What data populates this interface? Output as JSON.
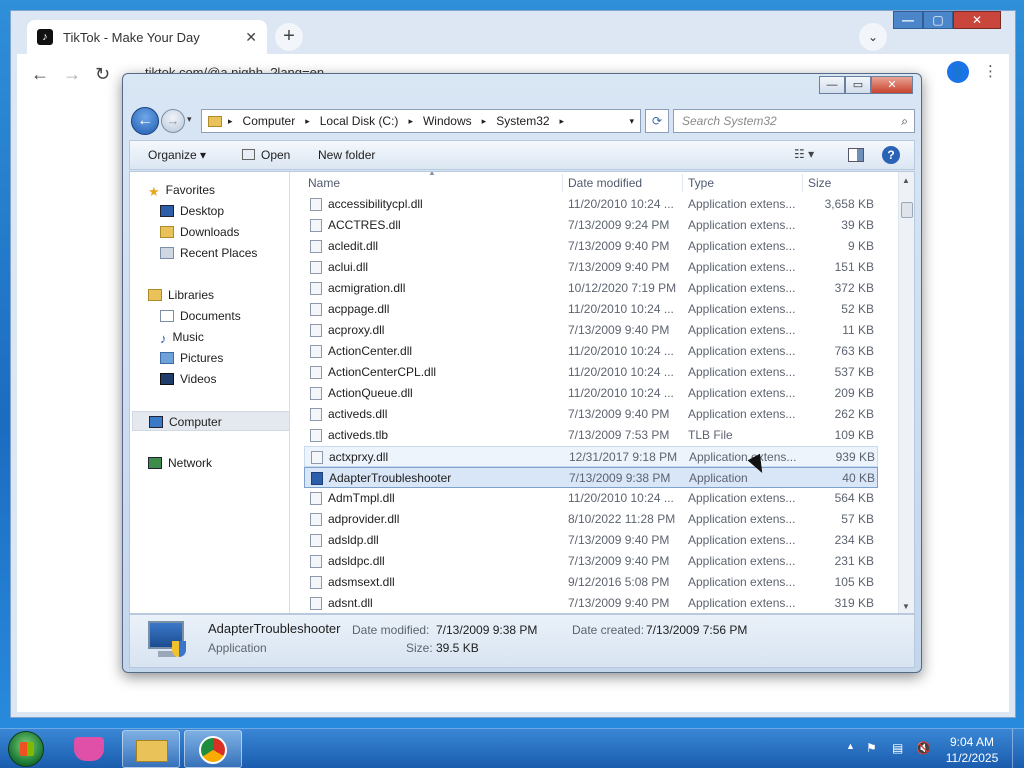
{
  "browser": {
    "tab_title": "TikTok - Make Your Day",
    "tab_close": "✕",
    "new_tab": "+",
    "tab_search": "⌄",
    "url": "tiktok.com/@a.nighh_?lang=en",
    "back": "←",
    "forward": "→",
    "reload": "↻",
    "menu": "⋮",
    "win_min": "—",
    "win_max": "▢",
    "win_close": "✕"
  },
  "explorer": {
    "caption": {
      "min": "—",
      "max": "▭",
      "close": "✕"
    },
    "nav": {
      "back": "←",
      "forward": "→",
      "dropdown": "▾"
    },
    "breadcrumb": [
      "Computer",
      "Local Disk (C:)",
      "Windows",
      "System32"
    ],
    "breadcrumb_sep": "▸",
    "refresh": "⟳",
    "search_placeholder": "Search System32",
    "search_icon": "⌕",
    "toolbar": {
      "organize": "Organize ▾",
      "open": "Open",
      "new_folder": "New folder",
      "views": "☷ ▾",
      "help": "?"
    },
    "navpane": {
      "favorites": "Favorites",
      "desktop": "Desktop",
      "downloads": "Downloads",
      "recent_places": "Recent Places",
      "libraries": "Libraries",
      "documents": "Documents",
      "music": "Music",
      "pictures": "Pictures",
      "videos": "Videos",
      "computer": "Computer",
      "network": "Network"
    },
    "columns": {
      "name": "Name",
      "date": "Date modified",
      "type": "Type",
      "size": "Size",
      "sort": "▲"
    },
    "files": [
      {
        "name": "accessibilitycpl.dll",
        "date": "11/20/2010 10:24 ...",
        "type": "Application extens...",
        "size": "3,658 KB"
      },
      {
        "name": "ACCTRES.dll",
        "date": "7/13/2009 9:24 PM",
        "type": "Application extens...",
        "size": "39 KB"
      },
      {
        "name": "acledit.dll",
        "date": "7/13/2009 9:40 PM",
        "type": "Application extens...",
        "size": "9 KB"
      },
      {
        "name": "aclui.dll",
        "date": "7/13/2009 9:40 PM",
        "type": "Application extens...",
        "size": "151 KB"
      },
      {
        "name": "acmigration.dll",
        "date": "10/12/2020 7:19 PM",
        "type": "Application extens...",
        "size": "372 KB"
      },
      {
        "name": "acppage.dll",
        "date": "11/20/2010 10:24 ...",
        "type": "Application extens...",
        "size": "52 KB"
      },
      {
        "name": "acproxy.dll",
        "date": "7/13/2009 9:40 PM",
        "type": "Application extens...",
        "size": "11 KB"
      },
      {
        "name": "ActionCenter.dll",
        "date": "11/20/2010 10:24 ...",
        "type": "Application extens...",
        "size": "763 KB"
      },
      {
        "name": "ActionCenterCPL.dll",
        "date": "11/20/2010 10:24 ...",
        "type": "Application extens...",
        "size": "537 KB"
      },
      {
        "name": "ActionQueue.dll",
        "date": "11/20/2010 10:24 ...",
        "type": "Application extens...",
        "size": "209 KB"
      },
      {
        "name": "activeds.dll",
        "date": "7/13/2009 9:40 PM",
        "type": "Application extens...",
        "size": "262 KB"
      },
      {
        "name": "activeds.tlb",
        "date": "7/13/2009 7:53 PM",
        "type": "TLB File",
        "size": "109 KB"
      },
      {
        "name": "actxprxy.dll",
        "date": "12/31/2017 9:18 PM",
        "type": "Application extens...",
        "size": "939 KB"
      },
      {
        "name": "AdapterTroubleshooter",
        "date": "7/13/2009 9:38 PM",
        "type": "Application",
        "size": "40 KB"
      },
      {
        "name": "AdmTmpl.dll",
        "date": "11/20/2010 10:24 ...",
        "type": "Application extens...",
        "size": "564 KB"
      },
      {
        "name": "adprovider.dll",
        "date": "8/10/2022 11:28 PM",
        "type": "Application extens...",
        "size": "57 KB"
      },
      {
        "name": "adsldp.dll",
        "date": "7/13/2009 9:40 PM",
        "type": "Application extens...",
        "size": "234 KB"
      },
      {
        "name": "adsldpc.dll",
        "date": "7/13/2009 9:40 PM",
        "type": "Application extens...",
        "size": "231 KB"
      },
      {
        "name": "adsmsext.dll",
        "date": "9/12/2016 5:08 PM",
        "type": "Application extens...",
        "size": "105 KB"
      },
      {
        "name": "adsnt.dll",
        "date": "7/13/2009 9:40 PM",
        "type": "Application extens...",
        "size": "319 KB"
      }
    ],
    "selected_index": 13,
    "hover_index": 12,
    "details": {
      "name": "AdapterTroubleshooter",
      "type": "Application",
      "date_modified_label": "Date modified:",
      "date_modified": "7/13/2009 9:38 PM",
      "size_label": "Size:",
      "size": "39.5 KB",
      "date_created_label": "Date created:",
      "date_created": "7/13/2009 7:56 PM"
    }
  },
  "taskbar": {
    "clock_time": "9:04 AM",
    "clock_date": "11/2/2025",
    "tray_up": "▲"
  }
}
